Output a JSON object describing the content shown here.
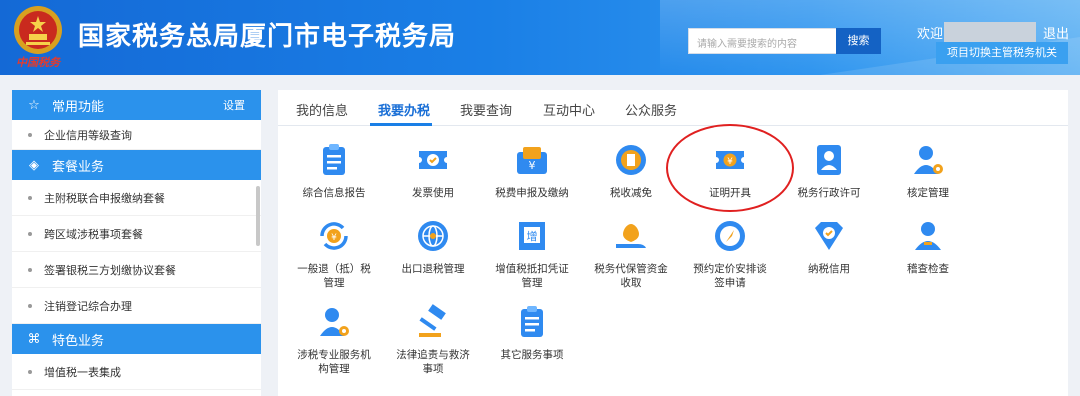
{
  "header": {
    "title": "国家税务总局厦门市电子税务局",
    "emblem_text": "中国税务",
    "search_placeholder": "请输入需要搜索的内容",
    "search_button": "搜索",
    "welcome": "欢迎",
    "logout": "退出",
    "switch_button": "项目切换主管税务机关"
  },
  "sidebar": {
    "sections": [
      {
        "title": "常用功能",
        "right": "设置",
        "icon": "star-icon"
      },
      {
        "title": "套餐业务",
        "icon": "layers-icon"
      },
      {
        "title": "特色业务",
        "icon": "grid-icon"
      }
    ],
    "common_items": [
      "企业信用等级查询"
    ],
    "package_items": [
      "主附税联合申报缴纳套餐",
      "跨区域涉税事项套餐",
      "签署银税三方划缴协议套餐",
      "注销登记综合办理"
    ],
    "special_items": [
      "增值税一表集成"
    ]
  },
  "tabs": [
    "我的信息",
    "我要办税",
    "我要查询",
    "互动中心",
    "公众服务"
  ],
  "services": {
    "row1": [
      "综合信息报告",
      "发票使用",
      "税费申报及缴纳",
      "税收减免",
      "证明开具",
      "税务行政许可",
      "核定管理"
    ],
    "row2": [
      "一般退（抵）税\n管理",
      "出口退税管理",
      "增值税抵扣凭证\n管理",
      "税务代保管资金\n收取",
      "预约定价安排谈\n签申请",
      "纳税信用",
      "稽查检查"
    ],
    "row3": [
      "涉税专业服务机\n构管理",
      "法律追责与救济\n事项",
      "其它服务事项"
    ]
  },
  "icon_glyphs": {
    "invoice": "¥",
    "zeng": "增"
  }
}
